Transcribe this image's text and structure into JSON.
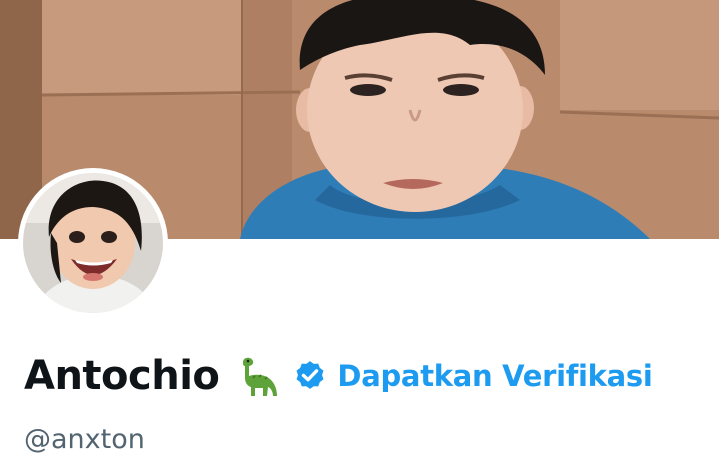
{
  "profile": {
    "display_name": "Antochio",
    "handle": "@anxton",
    "get_verified_label": "Dapatkan Verifikasi"
  },
  "banner": {
    "image": "child-portrait-photo"
  },
  "avatar": {
    "image": "smiling-child-photo"
  },
  "icons": {
    "name_emoji": "sauropod-dinosaur-icon",
    "verified": "verified-badge-icon"
  },
  "colors": {
    "accent": "#1d9bf0",
    "name_text": "#0f1419",
    "secondary_text": "#536471",
    "dino_green": "#5ea33a"
  }
}
